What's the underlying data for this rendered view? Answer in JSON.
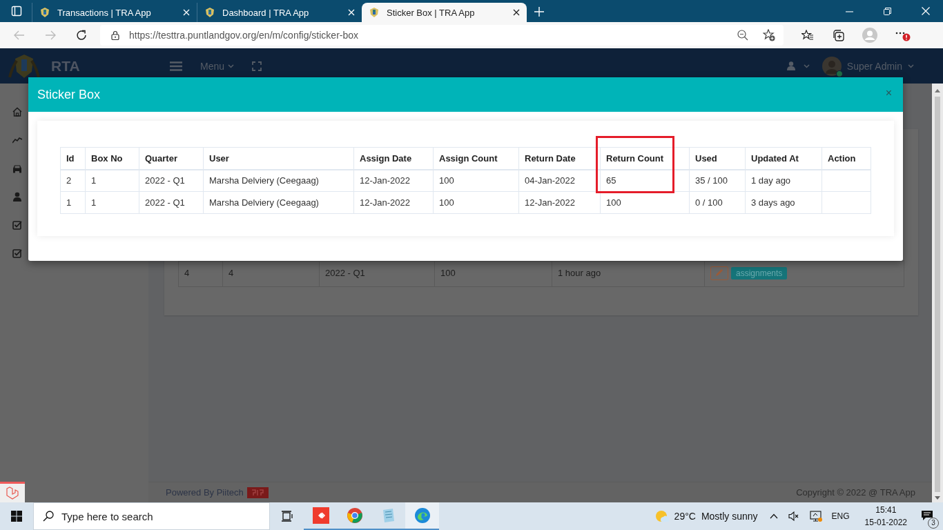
{
  "browser": {
    "tabs": [
      {
        "title": "Transactions | TRA App",
        "selected": false
      },
      {
        "title": "Dashboard | TRA App",
        "selected": false
      },
      {
        "title": "Sticker Box | TRA App",
        "selected": true
      }
    ],
    "url": "https://testtra.puntlandgov.org/en/m/config/sticker-box"
  },
  "navbar": {
    "brand": "RTA",
    "menu": "Menu",
    "user": {
      "name": "Super Admin",
      "online": true
    }
  },
  "background_table": {
    "rows": [
      {
        "cells": [
          "4",
          "4",
          "2022 - Q1",
          "100",
          "1 hour ago"
        ],
        "tag": "assignments"
      }
    ]
  },
  "footer": {
    "powered_by": "Powered By Piitech",
    "copyright": "Copyright © 2022 @ TRA App"
  },
  "modal": {
    "title": "Sticker Box",
    "close": "×",
    "table": {
      "columns": [
        {
          "label": "Id",
          "highlighted": false
        },
        {
          "label": "Box No",
          "highlighted": false
        },
        {
          "label": "Quarter",
          "highlighted": false
        },
        {
          "label": "User",
          "highlighted": false
        },
        {
          "label": "Assign Date",
          "highlighted": false
        },
        {
          "label": "Assign Count",
          "highlighted": false
        },
        {
          "label": "Return Date",
          "highlighted": false
        },
        {
          "label": "Return Count",
          "highlighted": true
        },
        {
          "label": "Used",
          "highlighted": false
        },
        {
          "label": "Updated At",
          "highlighted": false
        },
        {
          "label": "Action",
          "highlighted": false
        }
      ],
      "rows": [
        {
          "cells": [
            "2",
            "1",
            "2022 - Q1",
            "Marsha Delviery (Ceegaag)",
            "12-Jan-2022",
            "100",
            "04-Jan-2022",
            "65",
            "35 / 100",
            "1 day ago",
            ""
          ],
          "highlighted": true
        },
        {
          "cells": [
            "1",
            "1",
            "2022 - Q1",
            "Marsha Delviery (Ceegaag)",
            "12-Jan-2022",
            "100",
            "12-Jan-2022",
            "100",
            "0 / 100",
            "3 days ago",
            ""
          ],
          "highlighted": false
        }
      ]
    }
  },
  "taskbar": {
    "search_placeholder": "Type here to search",
    "weather": {
      "temperature": "29°C",
      "condition": "Mostly sunny"
    },
    "language": "ENG",
    "time": "15:41",
    "date": "15-01-2022",
    "notifications": "3"
  }
}
